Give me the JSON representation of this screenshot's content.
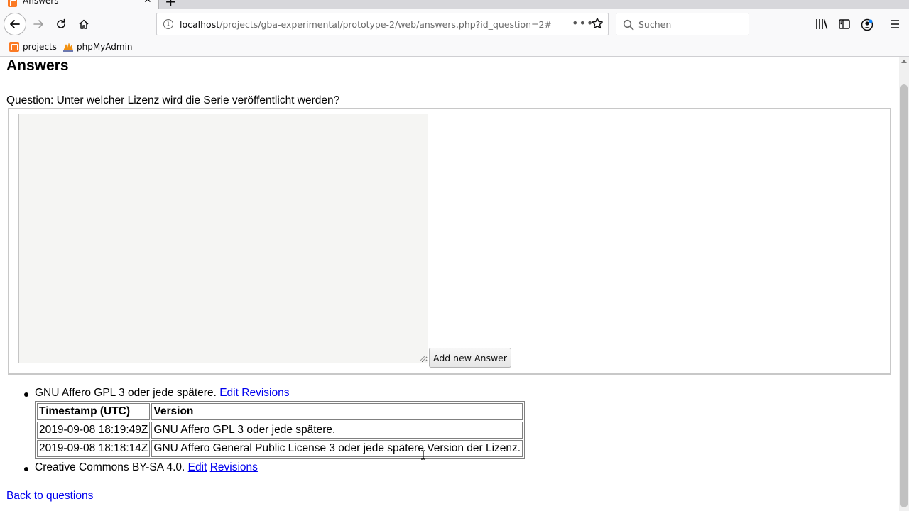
{
  "browser": {
    "tab_title": "Answers",
    "url_host": "localhost",
    "url_path": "/projects/gba-experimental/prototype-2/web/answers.php?id_question=2#",
    "url_dots": "•••",
    "search_placeholder": "Suchen",
    "bookmarks": [
      {
        "label": "projects",
        "icon": "xampp-icon"
      },
      {
        "label": "phpMyAdmin",
        "icon": "phpmyadmin-icon"
      }
    ]
  },
  "page": {
    "title": "Answers",
    "question": "Question: Unter welcher Lizenz wird die Serie veröffentlicht werden?",
    "form": {
      "textarea_value": "",
      "add_button_label": "Add new Answer"
    },
    "answers": [
      {
        "text": "GNU Affero GPL 3 oder jede spätere.",
        "edit_label": "Edit",
        "revisions_label": "Revisions",
        "revisions_table": {
          "headers": [
            "Timestamp (UTC)",
            "Version"
          ],
          "rows": [
            [
              "2019-09-08 18:19:49Z",
              "GNU Affero GPL 3 oder jede spätere."
            ],
            [
              "2019-09-08 18:18:14Z",
              "GNU Affero General Public License 3 oder jede spätere Version der Lizenz."
            ]
          ]
        }
      },
      {
        "text": "Creative Commons BY-SA 4.0.",
        "edit_label": "Edit",
        "revisions_label": "Revisions"
      }
    ],
    "back_link": "Back to questions"
  },
  "colors": {
    "link": "#0000ee",
    "chrome_bg": "#f9f9fa",
    "xampp_orange": "#fb7a24"
  }
}
